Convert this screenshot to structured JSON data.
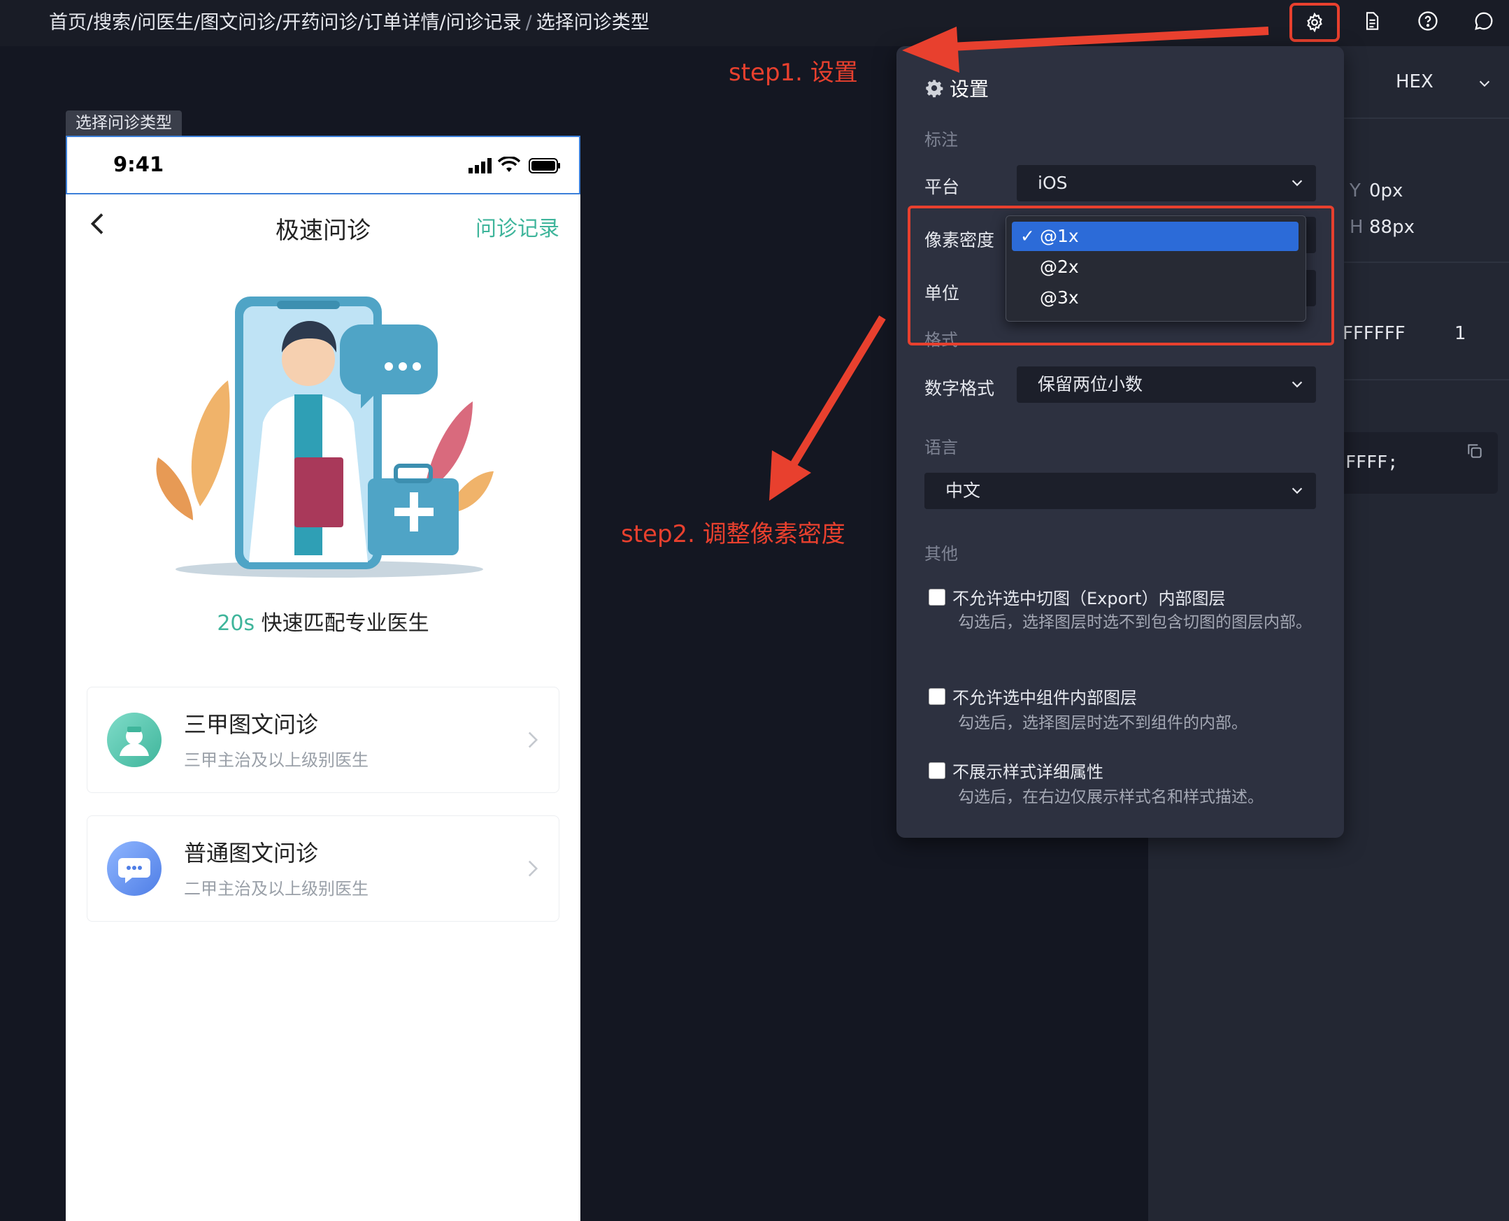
{
  "breadcrumb": {
    "path": "首页/搜索/问医生/图文问诊/开药问诊/订单详情/问诊记录",
    "separator": "/",
    "current": "选择问诊类型"
  },
  "toolbar": {
    "icons": [
      "gear-icon",
      "document-icon",
      "help-icon",
      "comment-icon"
    ]
  },
  "inspector": {
    "color_format": "HEX",
    "y_label": "Y",
    "y_value": "0px",
    "h_label": "H",
    "h_value": "88px",
    "fill_hex": "FFFFFF",
    "fill_opacity": "1",
    "code_snippet": "FFFF;"
  },
  "artboard": {
    "label": "选择问诊类型",
    "status_time": "9:41",
    "nav_title": "极速问诊",
    "nav_right": "问诊记录",
    "tagline_accent": "20s",
    "tagline_rest": " 快速匹配专业医生",
    "cards": [
      {
        "title": "三甲图文问诊",
        "subtitle": "三甲主治及以上级别医生"
      },
      {
        "title": "普通图文问诊",
        "subtitle": "二甲主治及以上级别医生"
      }
    ]
  },
  "settings": {
    "title": "设置",
    "section_annotation": "标注",
    "platform_label": "平台",
    "platform_value": "iOS",
    "density_label": "像素密度",
    "unit_label": "单位",
    "section_format": "格式",
    "number_format_label": "数字格式",
    "number_format_value": "保留两位小数",
    "section_language": "语言",
    "language_value": "中文",
    "section_other": "其他",
    "options": [
      {
        "label": "不允许选中切图（Export）内部图层",
        "desc": "勾选后，选择图层时选不到包含切图的图层内部。",
        "checked": false
      },
      {
        "label": "不允许选中组件内部图层",
        "desc": "勾选后，选择图层时选不到组件的内部。",
        "checked": false
      },
      {
        "label": "不展示样式详细属性",
        "desc": "勾选后，在右边仅展示样式名和样式描述。",
        "checked": false
      }
    ]
  },
  "density_menu": {
    "options": [
      "@1x",
      "@2x",
      "@3x"
    ],
    "selected": "@1x"
  },
  "annotations": {
    "step1": "step1. 设置",
    "step2": "step2. 调整像素密度"
  },
  "colors": {
    "accent_green": "#3fb59b",
    "annotation_red": "#e8402e",
    "menu_selected": "#2c6bd8",
    "panel_bg": "#2d3140"
  }
}
